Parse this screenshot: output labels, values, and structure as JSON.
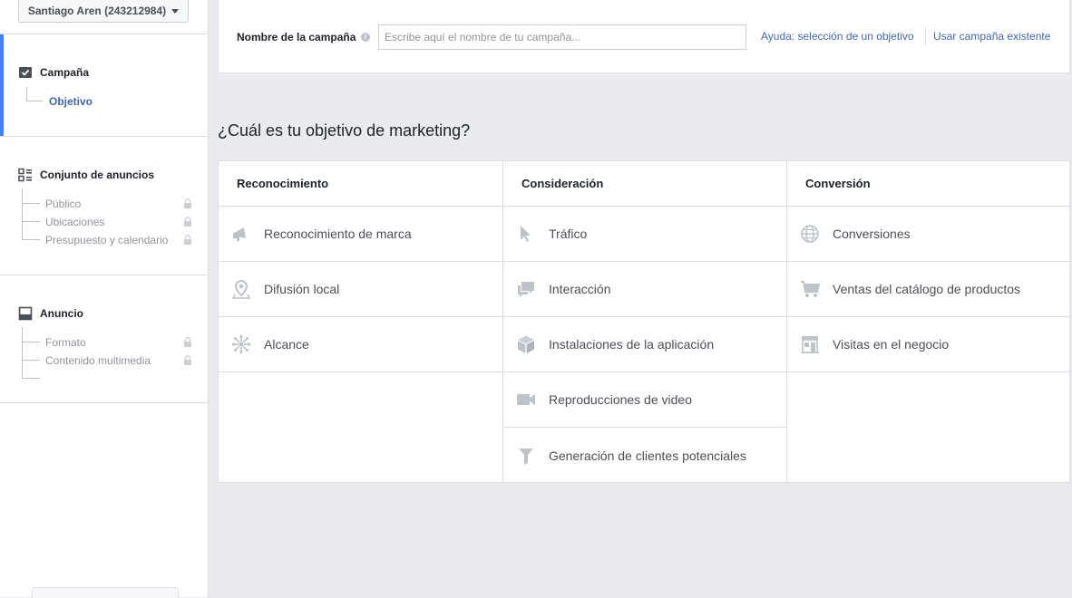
{
  "account": {
    "label": "Santiago Aren (243212984)"
  },
  "sidebar": {
    "campaign": {
      "title": "Campaña",
      "items": [
        {
          "label": "Objetivo"
        }
      ]
    },
    "adset": {
      "title": "Conjunto de anuncios",
      "items": [
        {
          "label": "Público"
        },
        {
          "label": "Ubicaciones"
        },
        {
          "label": "Presupuesto y calendario"
        }
      ]
    },
    "ad": {
      "title": "Anuncio",
      "items": [
        {
          "label": "Formato"
        },
        {
          "label": "Contenido multimedia"
        }
      ]
    }
  },
  "campaign_name": {
    "label": "Nombre de la campaña",
    "placeholder": "Escribe aquí el nombre de tu campaña...",
    "value": ""
  },
  "links": {
    "help": "Ayuda: selección de un objetivo",
    "existing": "Usar campaña existente"
  },
  "question": "¿Cuál es tu objetivo de marketing?",
  "columns": [
    {
      "title": "Reconocimiento",
      "options": [
        {
          "label": "Reconocimiento de marca",
          "icon": "megaphone-icon"
        },
        {
          "label": "Difusión local",
          "icon": "map-pin-icon"
        },
        {
          "label": "Alcance",
          "icon": "reach-burst-icon"
        }
      ]
    },
    {
      "title": "Consideración",
      "options": [
        {
          "label": "Tráfico",
          "icon": "cursor-icon"
        },
        {
          "label": "Interacción",
          "icon": "chat-bubbles-icon"
        },
        {
          "label": "Instalaciones de la aplicación",
          "icon": "box-icon"
        },
        {
          "label": "Reproducciones de video",
          "icon": "video-camera-icon"
        },
        {
          "label": "Generación de clientes potenciales",
          "icon": "funnel-icon"
        }
      ]
    },
    {
      "title": "Conversión",
      "options": [
        {
          "label": "Conversiones",
          "icon": "globe-icon"
        },
        {
          "label": "Ventas del catálogo de productos",
          "icon": "cart-icon"
        },
        {
          "label": "Visitas en el negocio",
          "icon": "store-icon"
        }
      ]
    }
  ],
  "colors": {
    "accent": "#4080ff",
    "link": "#4267b2",
    "icon": "#bec3c9"
  }
}
